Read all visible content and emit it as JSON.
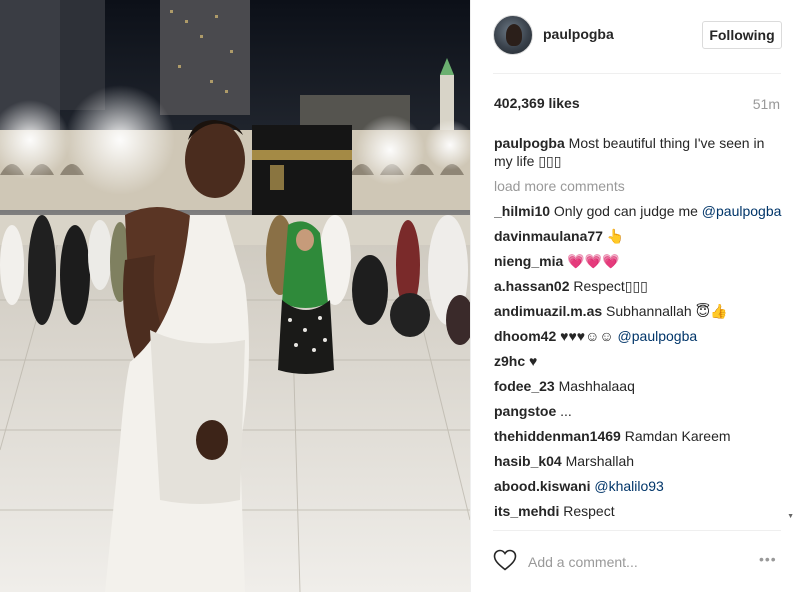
{
  "post": {
    "username": "paulpogba",
    "follow_label": "Following",
    "likes": "402,369 likes",
    "time": "51m",
    "caption_user": "paulpogba",
    "caption_text": "Most beautiful thing I've seen in my life ▯▯▯",
    "load_more": "load more comments"
  },
  "comments": [
    {
      "user": "_hilmi10",
      "text": "Only god can judge me ",
      "mention": "@paulpogba"
    },
    {
      "user": "davinmaulana77",
      "text": "👆",
      "mention": ""
    },
    {
      "user": "nieng_mia",
      "text": "💗💗💗",
      "mention": ""
    },
    {
      "user": "a.hassan02",
      "text": "Respect▯▯▯",
      "mention": ""
    },
    {
      "user": "andimuazil.m.as",
      "text": "Subhannallah 😇👍",
      "mention": ""
    },
    {
      "user": "dhoom42",
      "text": "♥♥♥☺☺ ",
      "mention": "@paulpogba"
    },
    {
      "user": "z9hc",
      "text": "♥",
      "mention": ""
    },
    {
      "user": "fodee_23",
      "text": "Mashhalaaq",
      "mention": ""
    },
    {
      "user": "pangstoe",
      "text": "...",
      "mention": ""
    },
    {
      "user": "thehiddenman1469",
      "text": "Ramdan Kareem",
      "mention": ""
    },
    {
      "user": "hasib_k04",
      "text": "Marshallah",
      "mention": ""
    },
    {
      "user": "abood.kiswani",
      "text": "",
      "mention": "@khalilo93"
    },
    {
      "user": "its_mehdi",
      "text": "Respect",
      "mention": ""
    }
  ],
  "add_comment": {
    "placeholder": "Add a comment...",
    "more": "•••"
  },
  "icons": {
    "heart": "heart-outline-icon",
    "more": "more-options-icon"
  },
  "colors": {
    "mention": "#003569",
    "muted": "#999999",
    "border": "#dbdbdb"
  }
}
